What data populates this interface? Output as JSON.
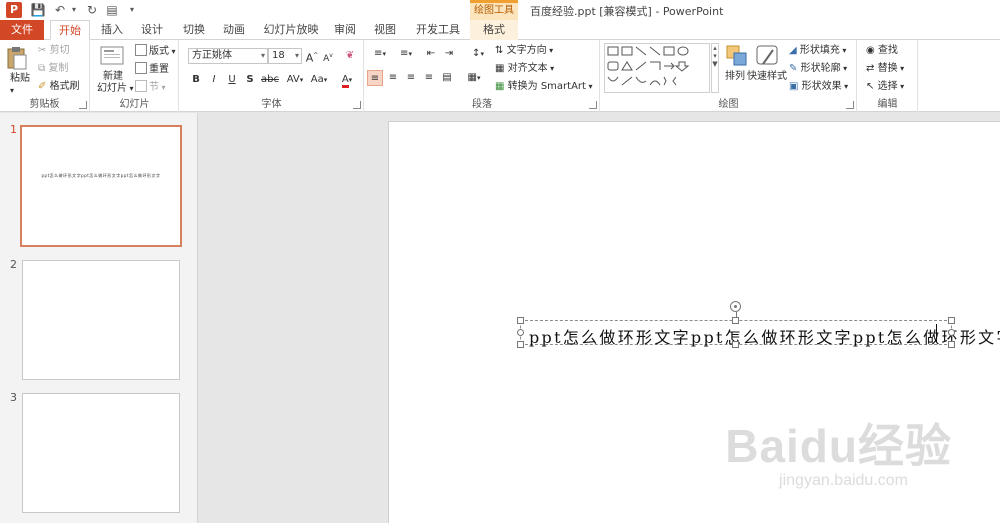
{
  "app": {
    "title": "百度经验.ppt [兼容模式] - PowerPoint",
    "logo_letter": "P",
    "accent": "#d24726",
    "contextual_header": "绘图工具"
  },
  "tabs": [
    "文件",
    "开始",
    "插入",
    "设计",
    "切换",
    "动画",
    "幻灯片放映",
    "审阅",
    "视图",
    "开发工具",
    "格式"
  ],
  "ribbon": {
    "clipboard": {
      "label": "剪贴板",
      "paste": "粘贴",
      "cut": "剪切",
      "copy": "复制",
      "format_painter": "格式刷"
    },
    "slides": {
      "label": "幻灯片",
      "new_slide": "新建",
      "new_slide2": "幻灯片",
      "layout": "版式",
      "reset": "重置",
      "section": "节"
    },
    "font": {
      "label": "字体",
      "font_name": "方正姚体",
      "font_size": "18",
      "bold": "B",
      "italic": "I",
      "underline": "U",
      "shadow": "S",
      "strike": "abc",
      "spacing": "AV",
      "case": "Aa",
      "color": "A",
      "grow": "A",
      "shrink": "A"
    },
    "paragraph": {
      "label": "段落",
      "text_direction": "文字方向",
      "align_text": "对齐文本",
      "smartart": "转换为 SmartArt"
    },
    "drawing": {
      "label": "绘图",
      "arrange": "排列",
      "quick_styles": "快速样式",
      "shape_fill": "形状填充",
      "shape_outline": "形状轮廓",
      "shape_effects": "形状效果"
    },
    "editing": {
      "label": "编辑",
      "find": "查找",
      "replace": "替换",
      "select": "选择"
    }
  },
  "thumbnails": [
    {
      "number": "1",
      "text": "ppt怎么做环形文字ppt怎么做环形文字ppt怎么做环形文字"
    },
    {
      "number": "2",
      "text": ""
    },
    {
      "number": "3",
      "text": ""
    }
  ],
  "slide": {
    "textbox_text": "ppt怎么做环形文字ppt怎么做环形文字ppt怎么做环形文字"
  },
  "watermark": {
    "logo": "Baidu经验",
    "url": "jingyan.baidu.com"
  }
}
